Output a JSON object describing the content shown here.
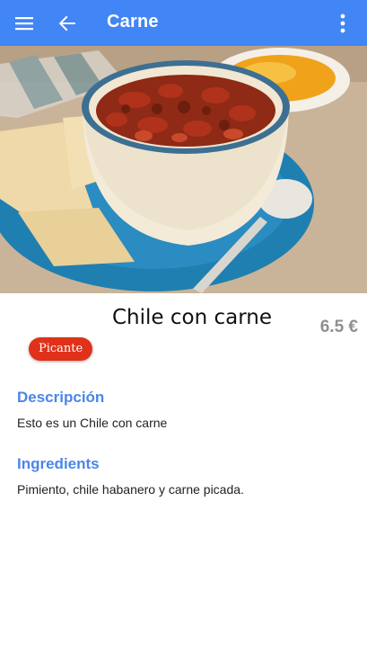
{
  "appbar": {
    "title": "Carne",
    "menu_icon": "menu-icon",
    "back_icon": "arrow-back-icon",
    "more_icon": "more-vert-icon",
    "color": "#4285f4"
  },
  "dish": {
    "name": "Chile con carne",
    "price": "6.5 €",
    "tag": "Picante",
    "tag_color": "#e0311a"
  },
  "sections": {
    "description_title": "Descripción",
    "description_text": "Esto es un Chile con carne",
    "ingredients_title": "Ingredients",
    "ingredients_text": "Pimiento, chile habanero y carne picada."
  }
}
